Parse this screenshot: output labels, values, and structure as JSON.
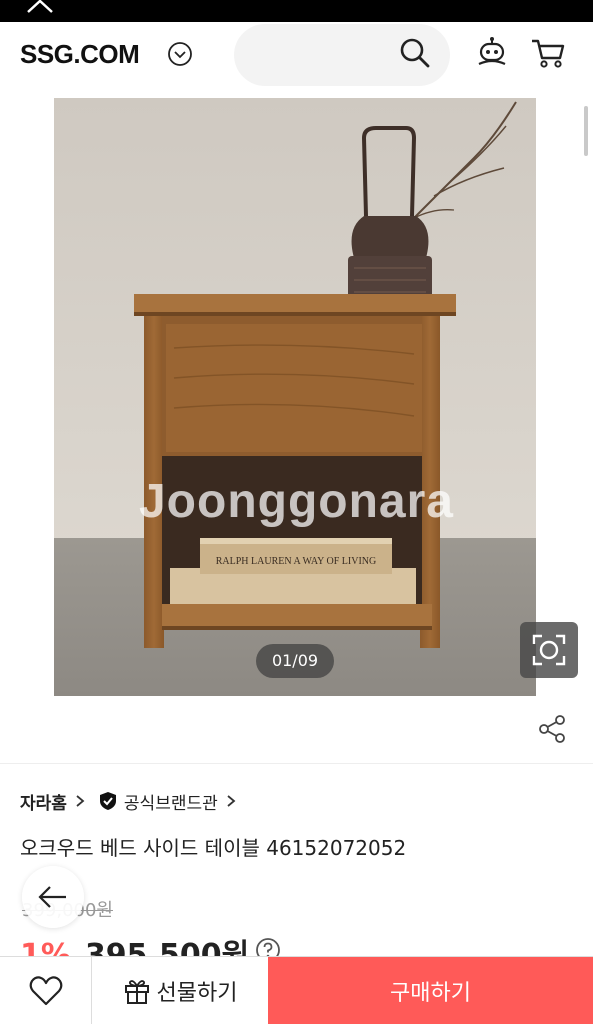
{
  "header": {
    "logo": "SSG.COM",
    "search_placeholder": ""
  },
  "gallery": {
    "watermark": "Joonggonara",
    "book_spine_text": "RALPH LAUREN A WAY OF LIVING",
    "counter": "01/09"
  },
  "product": {
    "brand": "자라홈",
    "official_label": "공식브랜드관",
    "title": "오크우드 베드 사이드 테이블 46152072052",
    "original_price": "399,000원",
    "discount_percent": "1%",
    "sale_price": "395,500원"
  },
  "bottom_bar": {
    "gift_label": "선물하기",
    "buy_label": "구매하기"
  },
  "colors": {
    "accent": "#ff5a58",
    "discount": "#ff5b59"
  }
}
